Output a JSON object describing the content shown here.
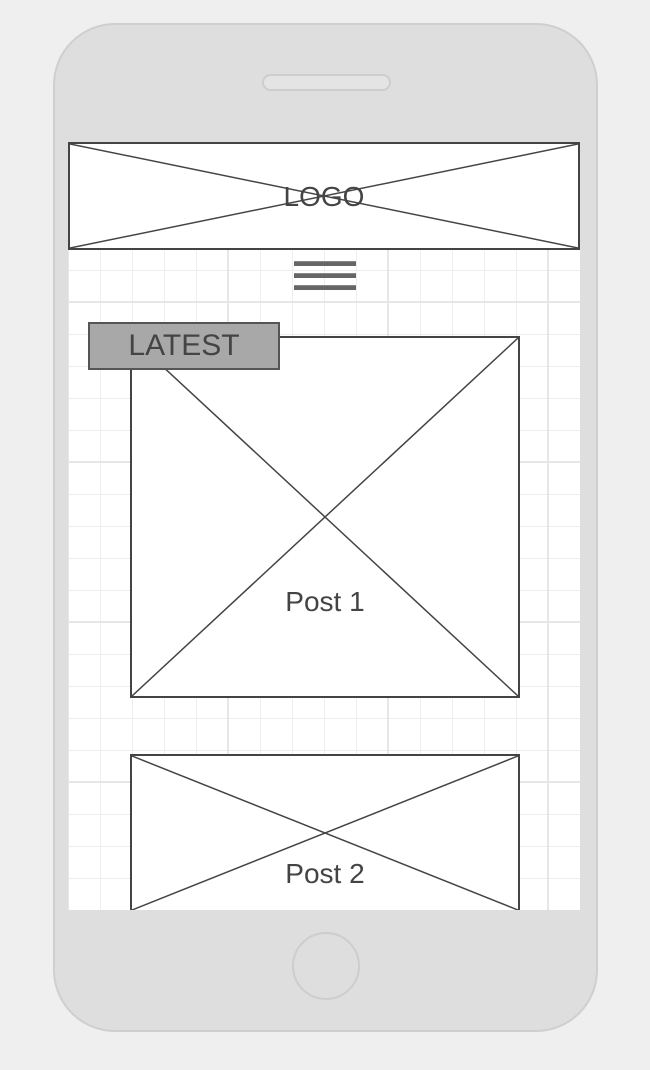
{
  "header": {
    "logo_label": "LOGO",
    "menu_icon": "hamburger-menu-icon"
  },
  "section": {
    "badge_label": "LATEST"
  },
  "posts": [
    {
      "label": "Post 1"
    },
    {
      "label": "Post 2"
    }
  ],
  "colors": {
    "background": "#efefef",
    "device_body": "#dedede",
    "device_outline": "#cfcfcf",
    "screen": "#ffffff",
    "grid_line": "#e6e6e6",
    "wireframe_stroke": "#444444",
    "badge_fill": "#a8a8a8"
  }
}
